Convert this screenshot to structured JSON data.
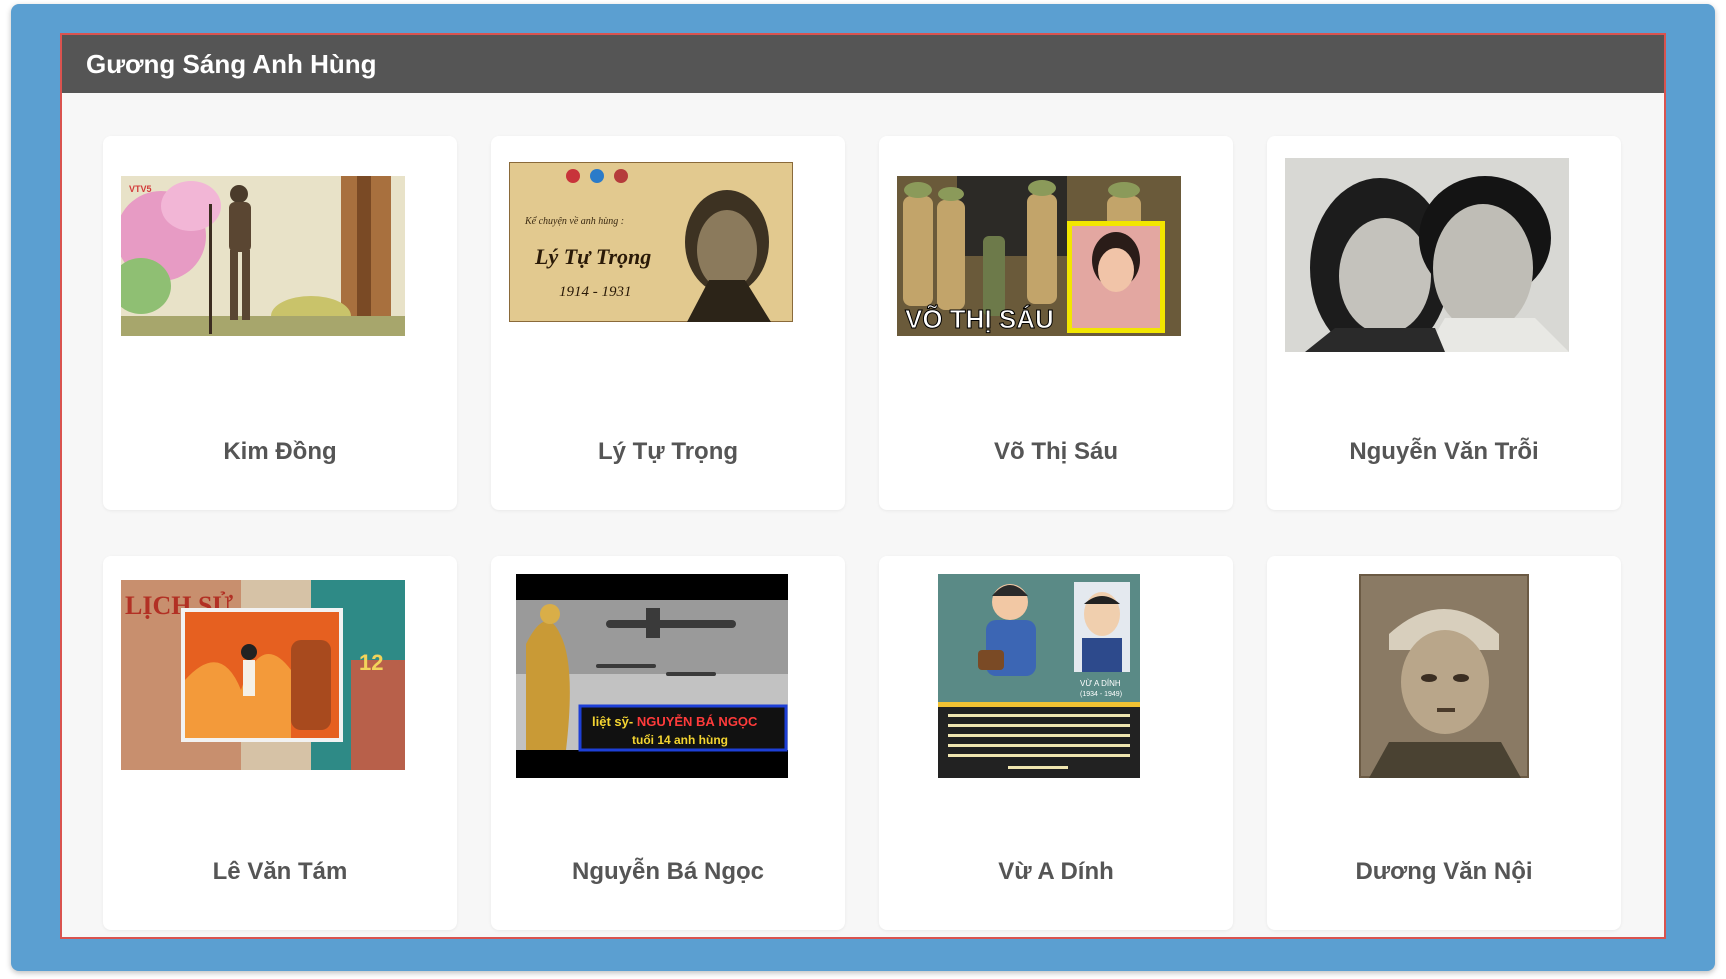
{
  "panel": {
    "title": "Gương Sáng Anh Hùng"
  },
  "heroes": [
    {
      "name": "Kim Đồng",
      "image": {
        "logo_text": "VTV5"
      }
    },
    {
      "name": "Lý Tự Trọng",
      "image": {
        "line1": "Kể chuyện về anh hùng :",
        "line2": "Lý Tự Trọng",
        "line3": "1914 - 1931"
      }
    },
    {
      "name": "Võ Thị Sáu",
      "image": {
        "caption": "VÕ THỊ SÁU"
      }
    },
    {
      "name": "Nguyễn Văn Trỗi",
      "image": {}
    },
    {
      "name": "Lê Văn Tám",
      "image": {
        "book_text": "LỊCH SỬ",
        "book_number": "12"
      }
    },
    {
      "name": "Nguyễn Bá Ngọc",
      "image": {
        "caption_prefix": "liệt sỹ-",
        "caption_name": "NGUYỄN BÁ NGỌC",
        "caption_sub": "tuổi 14 anh hùng"
      }
    },
    {
      "name": "Vừ A Dính",
      "image": {
        "label": "VỪ A DÍNH",
        "years": "(1934 - 1949)"
      }
    },
    {
      "name": "Dương Văn Nội",
      "image": {}
    }
  ],
  "colors": {
    "frame": "#5b9fd1",
    "header": "#555555",
    "panel_border": "#d9534f",
    "title_text": "#555555"
  }
}
